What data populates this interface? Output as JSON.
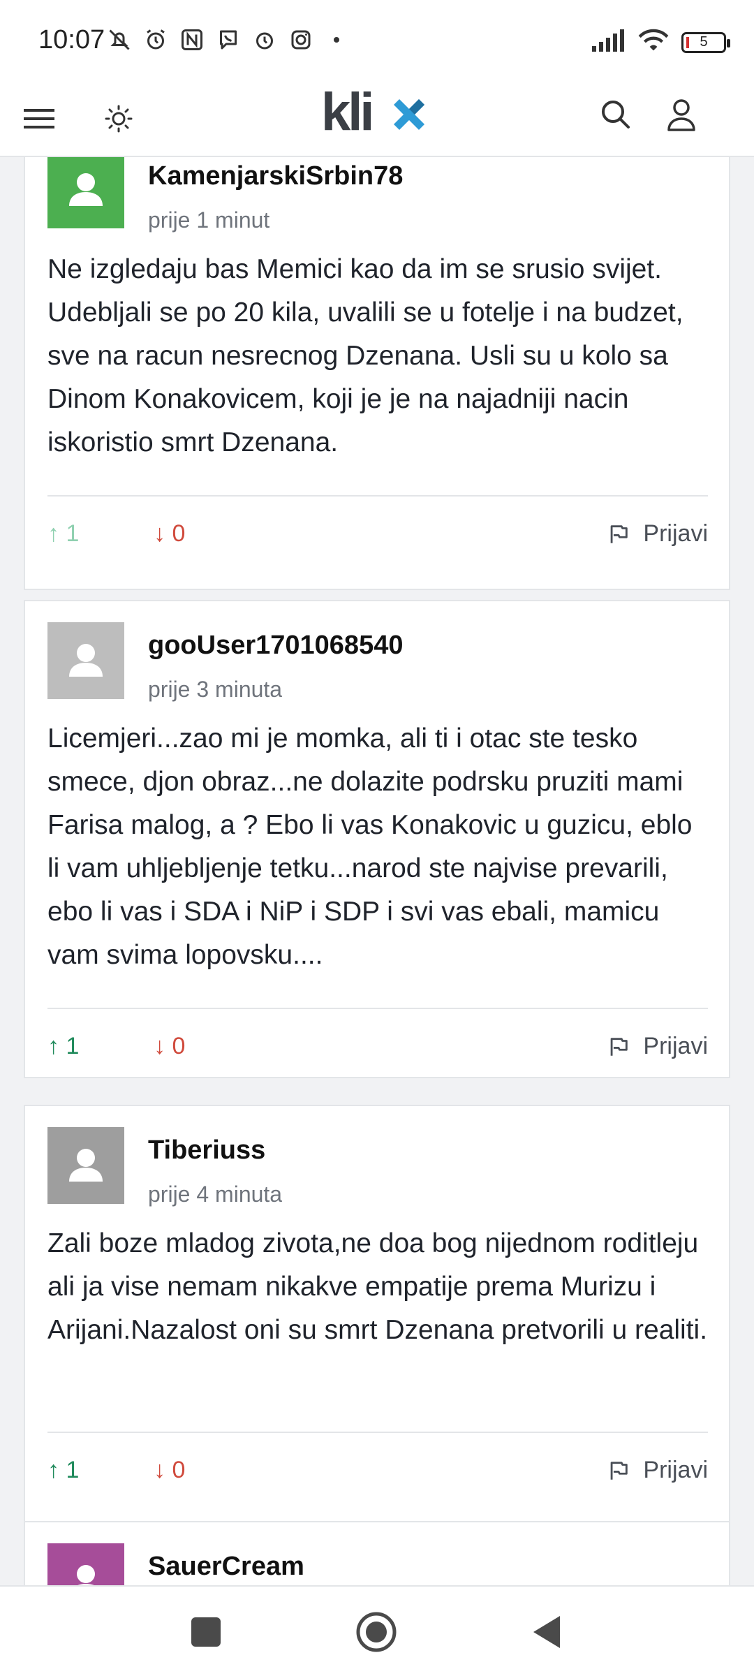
{
  "status_bar": {
    "time": "10:07",
    "battery": "5",
    "icons_left": [
      "mute-icon",
      "alarm-icon",
      "nfc-icon",
      "viber-icon",
      "alarm-icon",
      "instagram-icon"
    ],
    "icons_right": [
      "signal-icon",
      "wifi-icon",
      "battery-icon"
    ]
  },
  "header": {
    "logo_text": "klix",
    "icons": [
      "menu-icon",
      "theme-toggle-icon",
      "search-icon",
      "user-icon"
    ]
  },
  "comments": [
    {
      "username": "KamenjarskiSrbin78",
      "time": "prije 1 minut",
      "text": "Ne izgledaju bas Memici kao da im se srusio svijet. Udebljali se po 20 kila, uvalili se u fotelje i na budzet, sve na racun nesrecnog Dzenana. Usli su u kolo sa Dinom Konakovicem, koji je je na najadniji nacin iskoristio smrt Dzenana.",
      "upvotes": "↑ 1",
      "downvotes": "↓ 0",
      "report": "Prijavi",
      "avatar_color": "#4caf50"
    },
    {
      "username": "gooUser1701068540",
      "time": "prije 3 minuta",
      "text": "Licemjeri...zao mi je momka, ali ti i otac ste tesko smece, djon obraz...ne dolazite podrsku pruziti mami Farisa malog, a ? Ebo li vas Konakovic u guzicu, eblo li vam uhljebljenje tetku...narod ste najvise prevarili, ebo li vas i SDA i NiP i SDP i svi vas ebali, mamicu vam svima lopovsku....",
      "upvotes": "↑ 1",
      "downvotes": "↓ 0",
      "report": "Prijavi",
      "avatar_color": "#bdbdbd"
    },
    {
      "username": "Tiberiuss",
      "time": "prije 4 minuta",
      "text": "Zali boze mladog zivota,ne doa bog nijednom roditleju ali ja vise nemam nikakve empatije prema Murizu i Arijani.Nazalost oni su smrt Dzenana pretvorili u realiti.",
      "upvotes": "↑ 1",
      "downvotes": "↓ 0",
      "report": "Prijavi",
      "avatar_color": "#9e9e9e"
    },
    {
      "username": "SauerCream",
      "avatar_color": "#a64d99"
    }
  ],
  "nav_bar": {
    "buttons": [
      "recents-button",
      "home-button",
      "back-button"
    ]
  }
}
